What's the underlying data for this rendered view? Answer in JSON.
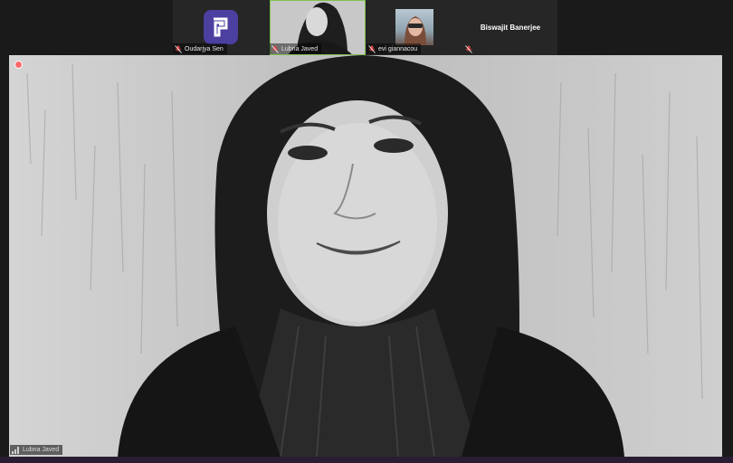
{
  "participants": [
    {
      "name": "Oudarjya Sen",
      "type": "app-logo",
      "muted": true
    },
    {
      "name": "Lubna Javed",
      "type": "video",
      "muted": true,
      "active_speaker": true
    },
    {
      "name": "evi giannacou",
      "type": "video",
      "muted": true
    },
    {
      "name": "Biswajit Banerjee",
      "type": "name-only",
      "muted": true
    }
  ],
  "main_view": {
    "speaker_name": "Lubna Javed",
    "speaker_name_shown": "Lubna Javed"
  },
  "colors": {
    "background": "#1a1a1a",
    "active_border": "#7cc34b",
    "logo_bg": "#4b3f9f",
    "mute_red": "#e04343"
  }
}
